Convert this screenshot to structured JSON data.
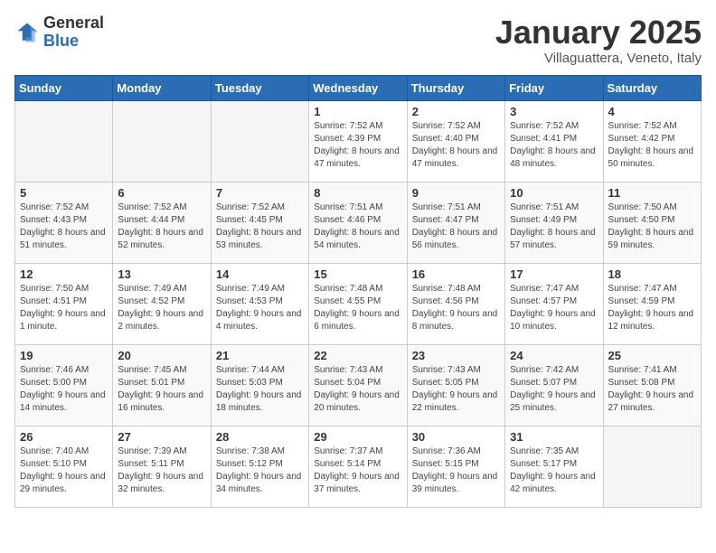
{
  "logo": {
    "general": "General",
    "blue": "Blue"
  },
  "header": {
    "title": "January 2025",
    "subtitle": "Villaguattera, Veneto, Italy"
  },
  "weekdays": [
    "Sunday",
    "Monday",
    "Tuesday",
    "Wednesday",
    "Thursday",
    "Friday",
    "Saturday"
  ],
  "weeks": [
    [
      {
        "day": "",
        "info": ""
      },
      {
        "day": "",
        "info": ""
      },
      {
        "day": "",
        "info": ""
      },
      {
        "day": "1",
        "info": "Sunrise: 7:52 AM\nSunset: 4:39 PM\nDaylight: 8 hours and 47 minutes."
      },
      {
        "day": "2",
        "info": "Sunrise: 7:52 AM\nSunset: 4:40 PM\nDaylight: 8 hours and 47 minutes."
      },
      {
        "day": "3",
        "info": "Sunrise: 7:52 AM\nSunset: 4:41 PM\nDaylight: 8 hours and 48 minutes."
      },
      {
        "day": "4",
        "info": "Sunrise: 7:52 AM\nSunset: 4:42 PM\nDaylight: 8 hours and 50 minutes."
      }
    ],
    [
      {
        "day": "5",
        "info": "Sunrise: 7:52 AM\nSunset: 4:43 PM\nDaylight: 8 hours and 51 minutes."
      },
      {
        "day": "6",
        "info": "Sunrise: 7:52 AM\nSunset: 4:44 PM\nDaylight: 8 hours and 52 minutes."
      },
      {
        "day": "7",
        "info": "Sunrise: 7:52 AM\nSunset: 4:45 PM\nDaylight: 8 hours and 53 minutes."
      },
      {
        "day": "8",
        "info": "Sunrise: 7:51 AM\nSunset: 4:46 PM\nDaylight: 8 hours and 54 minutes."
      },
      {
        "day": "9",
        "info": "Sunrise: 7:51 AM\nSunset: 4:47 PM\nDaylight: 8 hours and 56 minutes."
      },
      {
        "day": "10",
        "info": "Sunrise: 7:51 AM\nSunset: 4:49 PM\nDaylight: 8 hours and 57 minutes."
      },
      {
        "day": "11",
        "info": "Sunrise: 7:50 AM\nSunset: 4:50 PM\nDaylight: 8 hours and 59 minutes."
      }
    ],
    [
      {
        "day": "12",
        "info": "Sunrise: 7:50 AM\nSunset: 4:51 PM\nDaylight: 9 hours and 1 minute."
      },
      {
        "day": "13",
        "info": "Sunrise: 7:49 AM\nSunset: 4:52 PM\nDaylight: 9 hours and 2 minutes."
      },
      {
        "day": "14",
        "info": "Sunrise: 7:49 AM\nSunset: 4:53 PM\nDaylight: 9 hours and 4 minutes."
      },
      {
        "day": "15",
        "info": "Sunrise: 7:48 AM\nSunset: 4:55 PM\nDaylight: 9 hours and 6 minutes."
      },
      {
        "day": "16",
        "info": "Sunrise: 7:48 AM\nSunset: 4:56 PM\nDaylight: 9 hours and 8 minutes."
      },
      {
        "day": "17",
        "info": "Sunrise: 7:47 AM\nSunset: 4:57 PM\nDaylight: 9 hours and 10 minutes."
      },
      {
        "day": "18",
        "info": "Sunrise: 7:47 AM\nSunset: 4:59 PM\nDaylight: 9 hours and 12 minutes."
      }
    ],
    [
      {
        "day": "19",
        "info": "Sunrise: 7:46 AM\nSunset: 5:00 PM\nDaylight: 9 hours and 14 minutes."
      },
      {
        "day": "20",
        "info": "Sunrise: 7:45 AM\nSunset: 5:01 PM\nDaylight: 9 hours and 16 minutes."
      },
      {
        "day": "21",
        "info": "Sunrise: 7:44 AM\nSunset: 5:03 PM\nDaylight: 9 hours and 18 minutes."
      },
      {
        "day": "22",
        "info": "Sunrise: 7:43 AM\nSunset: 5:04 PM\nDaylight: 9 hours and 20 minutes."
      },
      {
        "day": "23",
        "info": "Sunrise: 7:43 AM\nSunset: 5:05 PM\nDaylight: 9 hours and 22 minutes."
      },
      {
        "day": "24",
        "info": "Sunrise: 7:42 AM\nSunset: 5:07 PM\nDaylight: 9 hours and 25 minutes."
      },
      {
        "day": "25",
        "info": "Sunrise: 7:41 AM\nSunset: 5:08 PM\nDaylight: 9 hours and 27 minutes."
      }
    ],
    [
      {
        "day": "26",
        "info": "Sunrise: 7:40 AM\nSunset: 5:10 PM\nDaylight: 9 hours and 29 minutes."
      },
      {
        "day": "27",
        "info": "Sunrise: 7:39 AM\nSunset: 5:11 PM\nDaylight: 9 hours and 32 minutes."
      },
      {
        "day": "28",
        "info": "Sunrise: 7:38 AM\nSunset: 5:12 PM\nDaylight: 9 hours and 34 minutes."
      },
      {
        "day": "29",
        "info": "Sunrise: 7:37 AM\nSunset: 5:14 PM\nDaylight: 9 hours and 37 minutes."
      },
      {
        "day": "30",
        "info": "Sunrise: 7:36 AM\nSunset: 5:15 PM\nDaylight: 9 hours and 39 minutes."
      },
      {
        "day": "31",
        "info": "Sunrise: 7:35 AM\nSunset: 5:17 PM\nDaylight: 9 hours and 42 minutes."
      },
      {
        "day": "",
        "info": ""
      }
    ]
  ]
}
